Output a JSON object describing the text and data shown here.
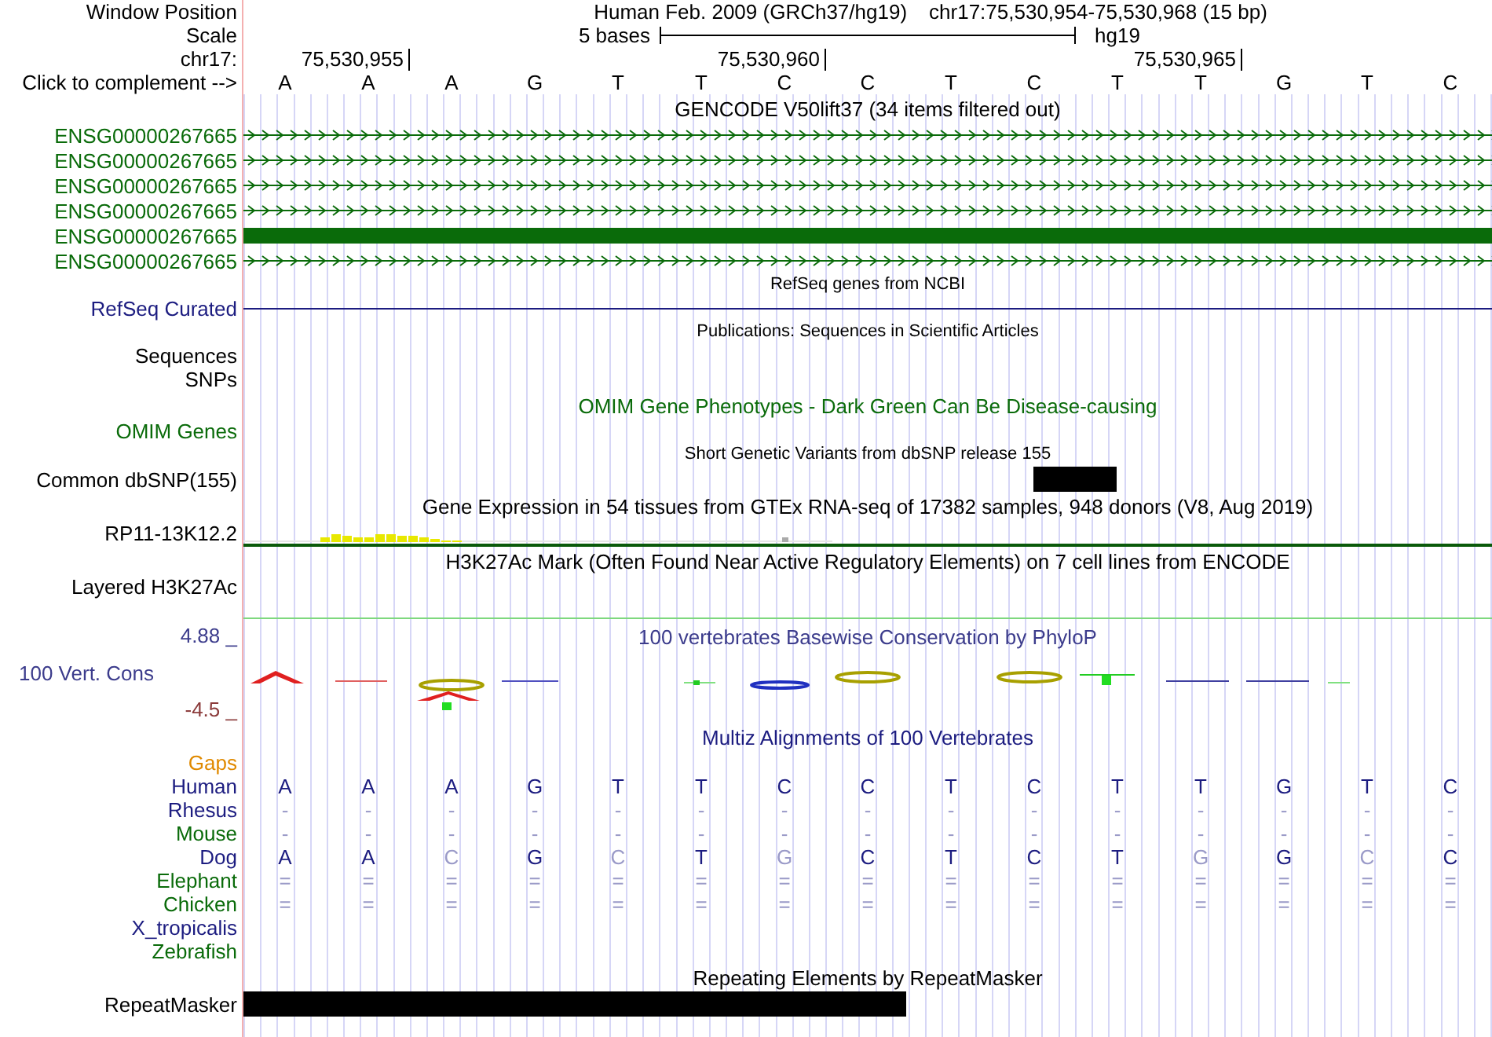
{
  "header": {
    "position_label": "Window Position",
    "assembly": "Human Feb. 2009 (GRCh37/hg19)",
    "position": "chr17:75,530,954-75,530,968 (15 bp)",
    "scale_label": "Scale",
    "scale_text": "5 bases",
    "scale_db": "hg19",
    "chrom_label": "chr17:",
    "ticks": [
      "75,530,955",
      "75,530,960",
      "75,530,965"
    ],
    "complement_label": "Click to complement -->",
    "bases": [
      "A",
      "A",
      "A",
      "G",
      "T",
      "T",
      "C",
      "C",
      "T",
      "C",
      "T",
      "T",
      "G",
      "T",
      "C"
    ]
  },
  "rows": [
    {
      "kind": "title",
      "text": "GENCODE V50lift37 (34 items filtered out)",
      "color": "#000000"
    },
    {
      "kind": "gene",
      "label": "ENSG00000267665",
      "color": "#0a6b0a",
      "thick": false
    },
    {
      "kind": "gene",
      "label": "ENSG00000267665",
      "color": "#0a6b0a",
      "thick": false
    },
    {
      "kind": "gene",
      "label": "ENSG00000267665",
      "color": "#0a6b0a",
      "thick": false
    },
    {
      "kind": "gene",
      "label": "ENSG00000267665",
      "color": "#0a6b0a",
      "thick": false
    },
    {
      "kind": "gene",
      "label": "ENSG00000267665",
      "color": "#0a6b0a",
      "thick": true
    },
    {
      "kind": "gene",
      "label": "ENSG00000267665",
      "color": "#0a6b0a",
      "thick": false
    },
    {
      "kind": "small_title",
      "text": "RefSeq genes from NCBI"
    },
    {
      "kind": "line",
      "label": "RefSeq Curated",
      "color": "#1c1c80"
    },
    {
      "kind": "small_title",
      "text": "Publications: Sequences in Scientific Articles"
    },
    {
      "kind": "empty",
      "label": "Sequences",
      "color": "#000000"
    },
    {
      "kind": "empty",
      "label": "SNPs",
      "color": "#000000"
    },
    {
      "kind": "title",
      "text": "OMIM Gene Phenotypes - Dark Green Can Be Disease-causing",
      "color": "#0a6b0a"
    },
    {
      "kind": "empty",
      "label": "OMIM Genes",
      "color": "#0a6b0a"
    },
    {
      "kind": "small_title",
      "text": "Short Genetic Variants from dbSNP release 155"
    },
    {
      "kind": "snp",
      "label": "Common dbSNP(155)",
      "color": "#000000"
    },
    {
      "kind": "title",
      "text": "Gene Expression in 54 tissues from GTEx RNA-seq of 17382 samples, 948 donors (V8, Aug 2019)",
      "color": "#000000"
    },
    {
      "kind": "expression",
      "label": "RP11-13K12.2",
      "color": "#000000"
    },
    {
      "kind": "title",
      "text": "H3K27Ac Mark (Often Found Near Active Regulatory Elements) on 7 cell lines from ENCODE",
      "color": "#000000"
    },
    {
      "kind": "empty",
      "label": "Layered H3K27Ac",
      "color": "#000000"
    },
    {
      "kind": "signal_line"
    },
    {
      "kind": "conservation",
      "title": "100 vertebrates Basewise Conservation by PhyloP",
      "label": "100 Vert. Cons",
      "color": "#3c3c8c",
      "max": "4.88 _",
      "min": "-4.5 _"
    },
    {
      "kind": "title",
      "text": "Multiz Alignments of 100 Vertebrates",
      "color": "#1c1c80"
    },
    {
      "kind": "empty",
      "label": "Gaps",
      "color": "#e08a00"
    },
    {
      "kind": "species",
      "label": "Human",
      "color": "#1c1c80",
      "bases": [
        "A",
        "A",
        "A",
        "G",
        "T",
        "T",
        "C",
        "C",
        "T",
        "C",
        "T",
        "T",
        "G",
        "T",
        "C"
      ]
    },
    {
      "kind": "species",
      "label": "Rhesus",
      "color": "#1c1c80",
      "bases": [
        "-",
        "-",
        "-",
        "-",
        "-",
        "-",
        "-",
        "-",
        "-",
        "-",
        "-",
        "-",
        "-",
        "-",
        "-"
      ]
    },
    {
      "kind": "species",
      "label": "Mouse",
      "color": "#0a6b0a",
      "bases": [
        "-",
        "-",
        "-",
        "-",
        "-",
        "-",
        "-",
        "-",
        "-",
        "-",
        "-",
        "-",
        "-",
        "-",
        "-"
      ]
    },
    {
      "kind": "species",
      "label": "Dog",
      "color": "#1c1c80",
      "bases": [
        "A",
        "A",
        "C",
        "G",
        "C",
        "T",
        "G",
        "C",
        "T",
        "C",
        "T",
        "G",
        "G",
        "C",
        "C"
      ],
      "faded": [
        false,
        false,
        true,
        false,
        true,
        false,
        true,
        false,
        false,
        false,
        false,
        true,
        false,
        true,
        false
      ]
    },
    {
      "kind": "species",
      "label": "Elephant",
      "color": "#0a6b0a",
      "bases": [
        "=",
        "=",
        "=",
        "=",
        "=",
        "=",
        "=",
        "=",
        "=",
        "=",
        "=",
        "=",
        "=",
        "=",
        "="
      ]
    },
    {
      "kind": "species",
      "label": "Chicken",
      "color": "#0a6b0a",
      "bases": [
        "=",
        "=",
        "=",
        "=",
        "=",
        "=",
        "=",
        "=",
        "=",
        "=",
        "=",
        "=",
        "=",
        "=",
        "="
      ]
    },
    {
      "kind": "empty",
      "label": "X_tropicalis",
      "color": "#1c1c80"
    },
    {
      "kind": "empty",
      "label": "Zebrafish",
      "color": "#0a6b0a"
    },
    {
      "kind": "title",
      "text": "Repeating Elements by RepeatMasker",
      "color": "#000000"
    },
    {
      "kind": "repeat",
      "label": "RepeatMasker",
      "color": "#000000"
    }
  ]
}
